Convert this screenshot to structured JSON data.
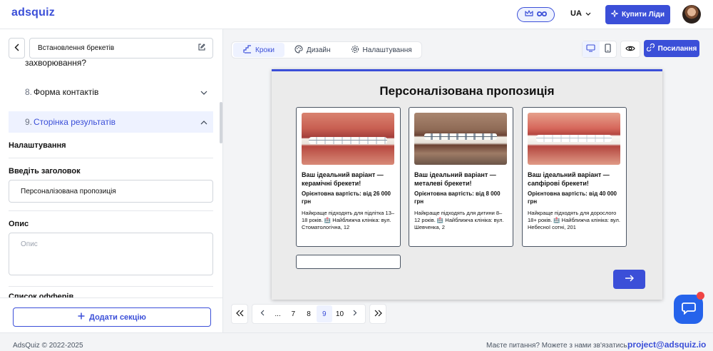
{
  "app": {
    "logo": "adsquiz"
  },
  "header": {
    "language": "UA",
    "buy_leads_label": "Купити Ліди"
  },
  "sidebar": {
    "quiz_title": "Встановлення брекетів",
    "prev_item_fragment": "захворювання?",
    "items": [
      {
        "number": "8.",
        "label": "Форма контактів"
      },
      {
        "number": "9.",
        "label": "Сторінка результатів"
      }
    ],
    "settings_heading": "Налаштування",
    "title_field_label": "Введіть заголовок",
    "title_field_value": "Персоналізована пропозиція",
    "description_label": "Опис",
    "description_placeholder": "Опис",
    "offers_label_partial": "Список офферів",
    "add_section_label": "Додати секцію"
  },
  "editor": {
    "tabs": [
      {
        "label": "Кроки"
      },
      {
        "label": "Дизайн"
      },
      {
        "label": "Налаштування"
      }
    ],
    "link_button_label": "Посилання"
  },
  "preview": {
    "title": "Персоналізована пропозиція",
    "cards": [
      {
        "title": "Ваш ідеальний варіант — керамічні брекети!",
        "price": "Орієнтовна вартість: від 26 000 грн",
        "description": "Найкраще підходять для підлітка 13–18 років. 🏥 Найближча клініка: вул. Стоматологічна, 12"
      },
      {
        "title": "Ваш ідеальний варіант — металеві брекети!",
        "price": "Орієнтовна вартість: від 8 000 грн",
        "description": "Найкраще підходять для дитини 8–12 років. 🏥 Найближча клініка: вул. Шевченка, 2"
      },
      {
        "title": "Ваш ідеальний варіант — сапфірові брекети!",
        "price": "Орієнтовна вартість: від 40 000 грн",
        "description": "Найкраще підходять для дорослого 18+ років. 🏥 Найближча клініка: вул. Небесної сотні, 201"
      }
    ]
  },
  "pagination": {
    "ellipsis": "...",
    "pages": [
      "7",
      "8",
      "9",
      "10"
    ],
    "current": "9"
  },
  "footer": {
    "copyright": "AdsQuiz © 2022-2025",
    "question": "Маєте питання? Можете з нами зв'язатись:",
    "email": "project@adsquiz.io"
  },
  "colors": {
    "accent": "#3b4fd8",
    "active_bg": "#eef2ff",
    "chat": "#2563eb",
    "badge": "#ef4444"
  }
}
